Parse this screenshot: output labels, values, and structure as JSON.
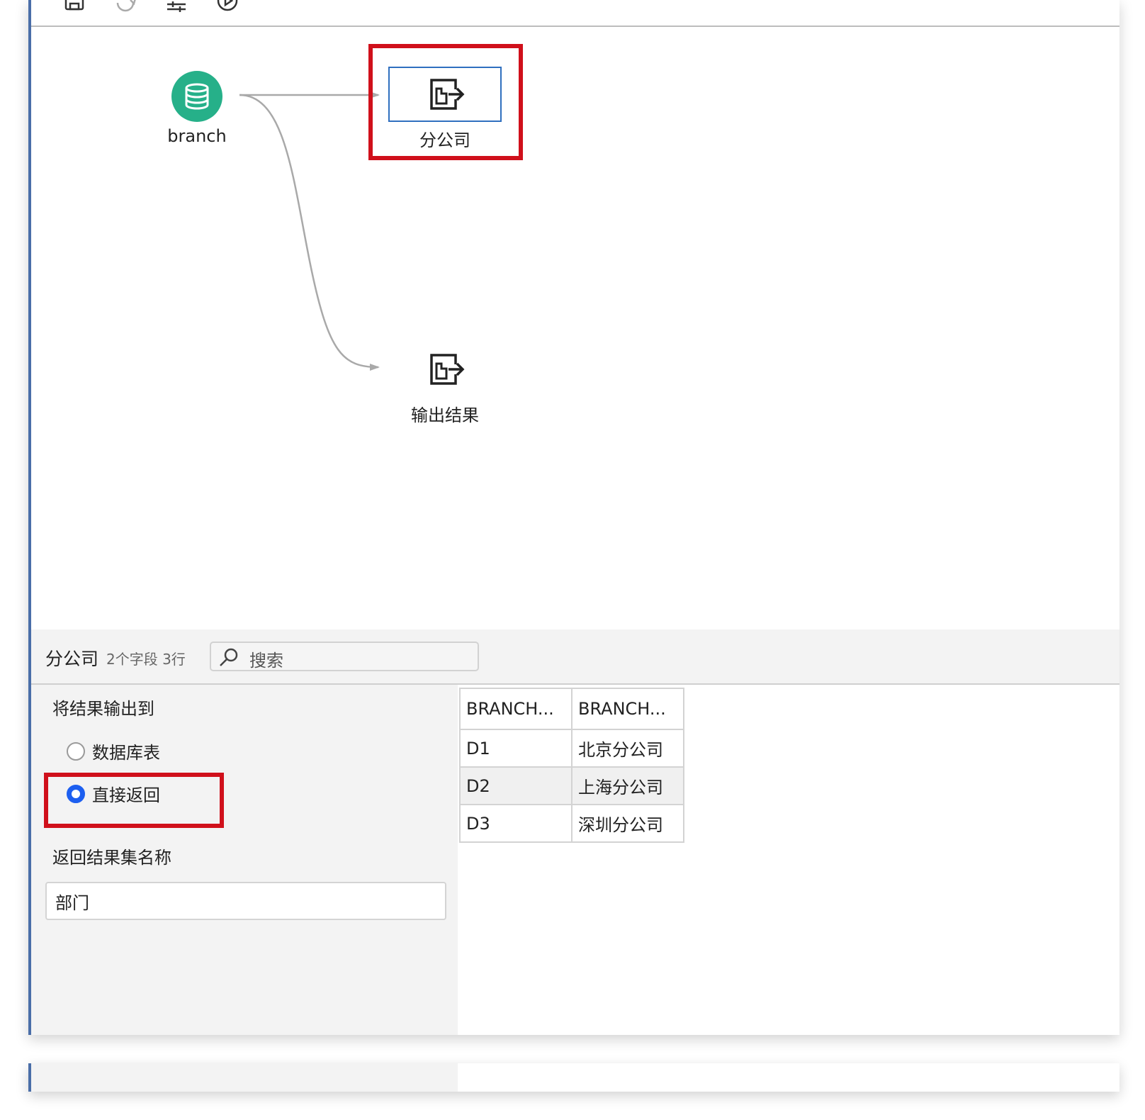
{
  "toolbar": {
    "icons": [
      "save-icon",
      "refresh-icon",
      "sliders-icon",
      "play-icon"
    ]
  },
  "canvas": {
    "nodes": {
      "source": {
        "label": "branch",
        "icon": "database-icon"
      },
      "output_selected": {
        "label": "分公司",
        "icon": "export-file-icon"
      },
      "output_result": {
        "label": "输出结果",
        "icon": "export-file-icon"
      }
    },
    "colors": {
      "source_node": "#26b089",
      "selection_box": "#2f6fbf",
      "highlight": "#d0101b",
      "edge": "#a9a9a9"
    }
  },
  "panel": {
    "title": "分公司",
    "meta": "2个字段  3行",
    "search_placeholder": "搜索"
  },
  "settings": {
    "output_label": "将结果输出到",
    "options": [
      {
        "label": "数据库表",
        "checked": false
      },
      {
        "label": "直接返回",
        "checked": true
      }
    ],
    "result_name_label": "返回结果集名称",
    "result_name_value": "部门"
  },
  "table": {
    "columns": [
      "BRANCH...",
      "BRANCH..."
    ],
    "rows": [
      [
        "D1",
        "北京分公司"
      ],
      [
        "D2",
        "上海分公司"
      ],
      [
        "D3",
        "深圳分公司"
      ]
    ]
  }
}
